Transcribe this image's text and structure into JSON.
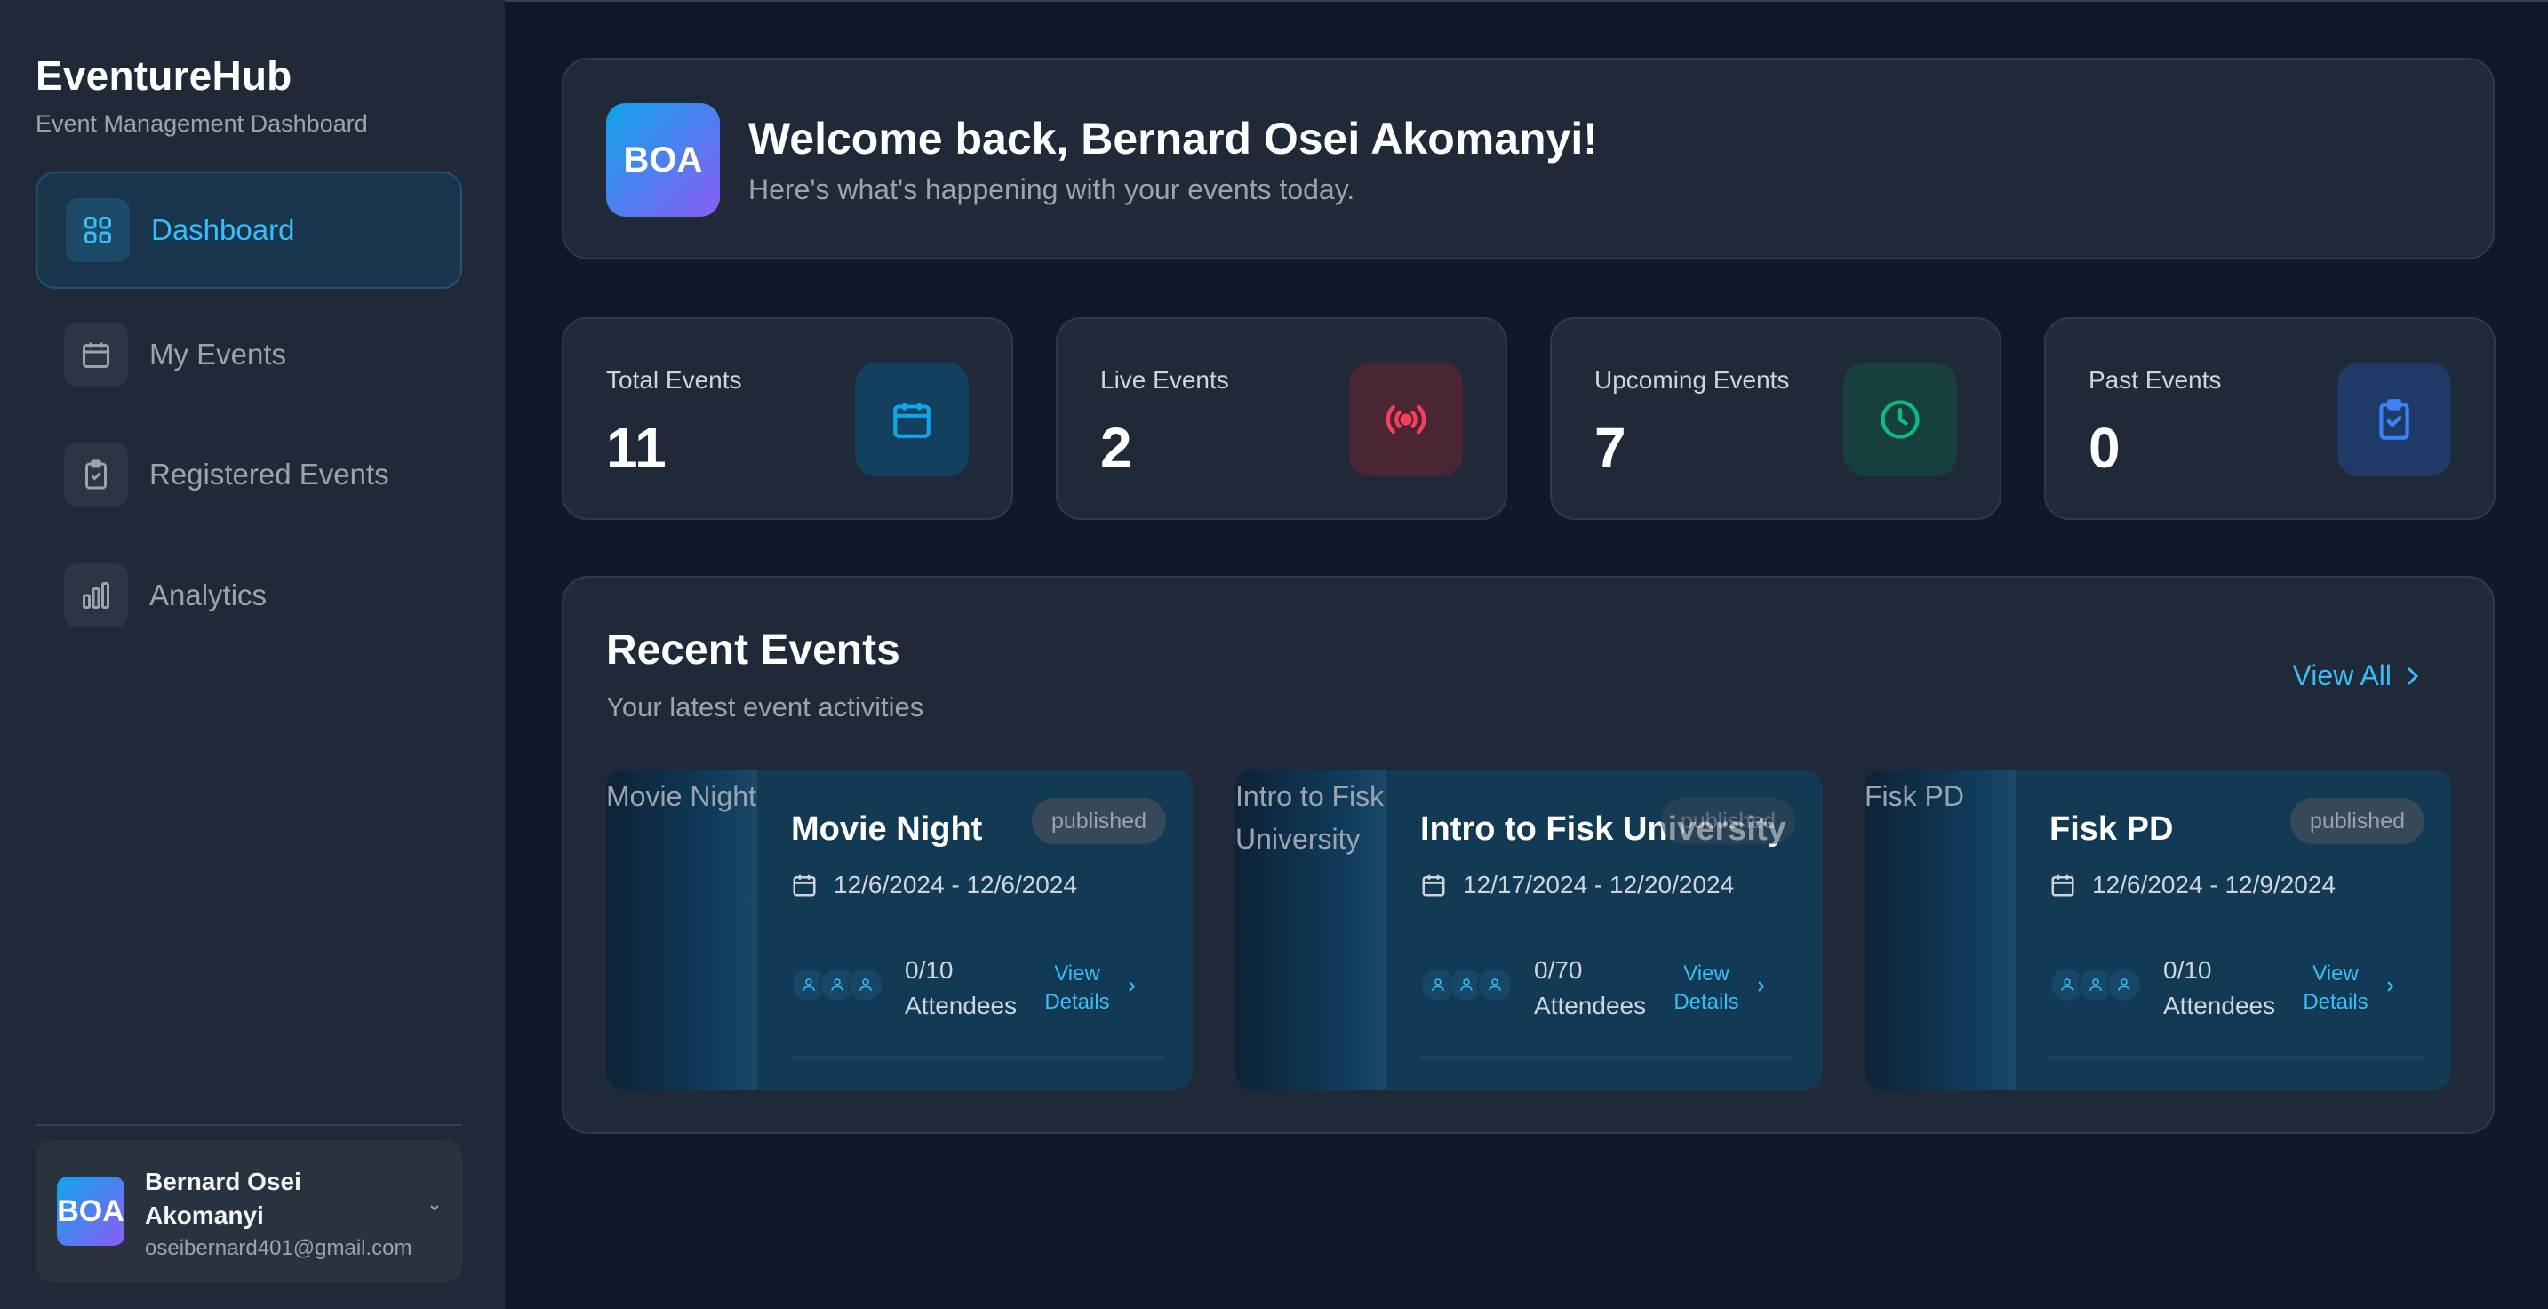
{
  "app": {
    "name": "EventureHub",
    "subtitle": "Event Management Dashboard"
  },
  "sidebar": {
    "items": [
      {
        "label": "Dashboard",
        "icon": "grid-icon",
        "active": true
      },
      {
        "label": "My Events",
        "icon": "calendar-icon",
        "active": false
      },
      {
        "label": "Registered Events",
        "icon": "clipboard-check-icon",
        "active": false
      },
      {
        "label": "Analytics",
        "icon": "bar-chart-icon",
        "active": false
      }
    ],
    "user": {
      "initials": "BOA",
      "name": "Bernard Osei Akomanyi",
      "email": "oseibernard401@gmail.com"
    }
  },
  "welcome": {
    "initials": "BOA",
    "title": "Welcome back, Bernard Osei Akomanyi!",
    "subtitle": "Here's what's happening with your events today."
  },
  "stats": [
    {
      "label": "Total Events",
      "value": "11",
      "icon": "calendar-icon",
      "color": "#0ea5e9"
    },
    {
      "label": "Live Events",
      "value": "2",
      "icon": "broadcast-icon",
      "color": "#f43f5e"
    },
    {
      "label": "Upcoming Events",
      "value": "7",
      "icon": "clock-icon",
      "color": "#10b981"
    },
    {
      "label": "Past Events",
      "value": "0",
      "icon": "clipboard-check-icon",
      "color": "#3b82f6"
    }
  ],
  "recent": {
    "title": "Recent Events",
    "subtitle": "Your latest event activities",
    "view_all": "View All",
    "events": [
      {
        "image_alt": "Movie Night",
        "title": "Movie Night",
        "status": "published",
        "dates": "12/6/2024 - 12/6/2024",
        "attendees": "0/10",
        "attendees_label": "Attendees",
        "view_details": "View Details"
      },
      {
        "image_alt": "Intro to Fisk University",
        "title": "Intro to Fisk University",
        "status": "published",
        "dates": "12/17/2024 - 12/20/2024",
        "attendees": "0/70",
        "attendees_label": "Attendees",
        "view_details": "View Details"
      },
      {
        "image_alt": "Fisk PD",
        "title": "Fisk PD",
        "status": "published",
        "dates": "12/6/2024 - 12/9/2024",
        "attendees": "0/10",
        "attendees_label": "Attendees",
        "view_details": "View Details"
      }
    ]
  },
  "colors": {
    "accent": "#38bdf8",
    "background": "#111827",
    "surface": "#1f2937"
  }
}
